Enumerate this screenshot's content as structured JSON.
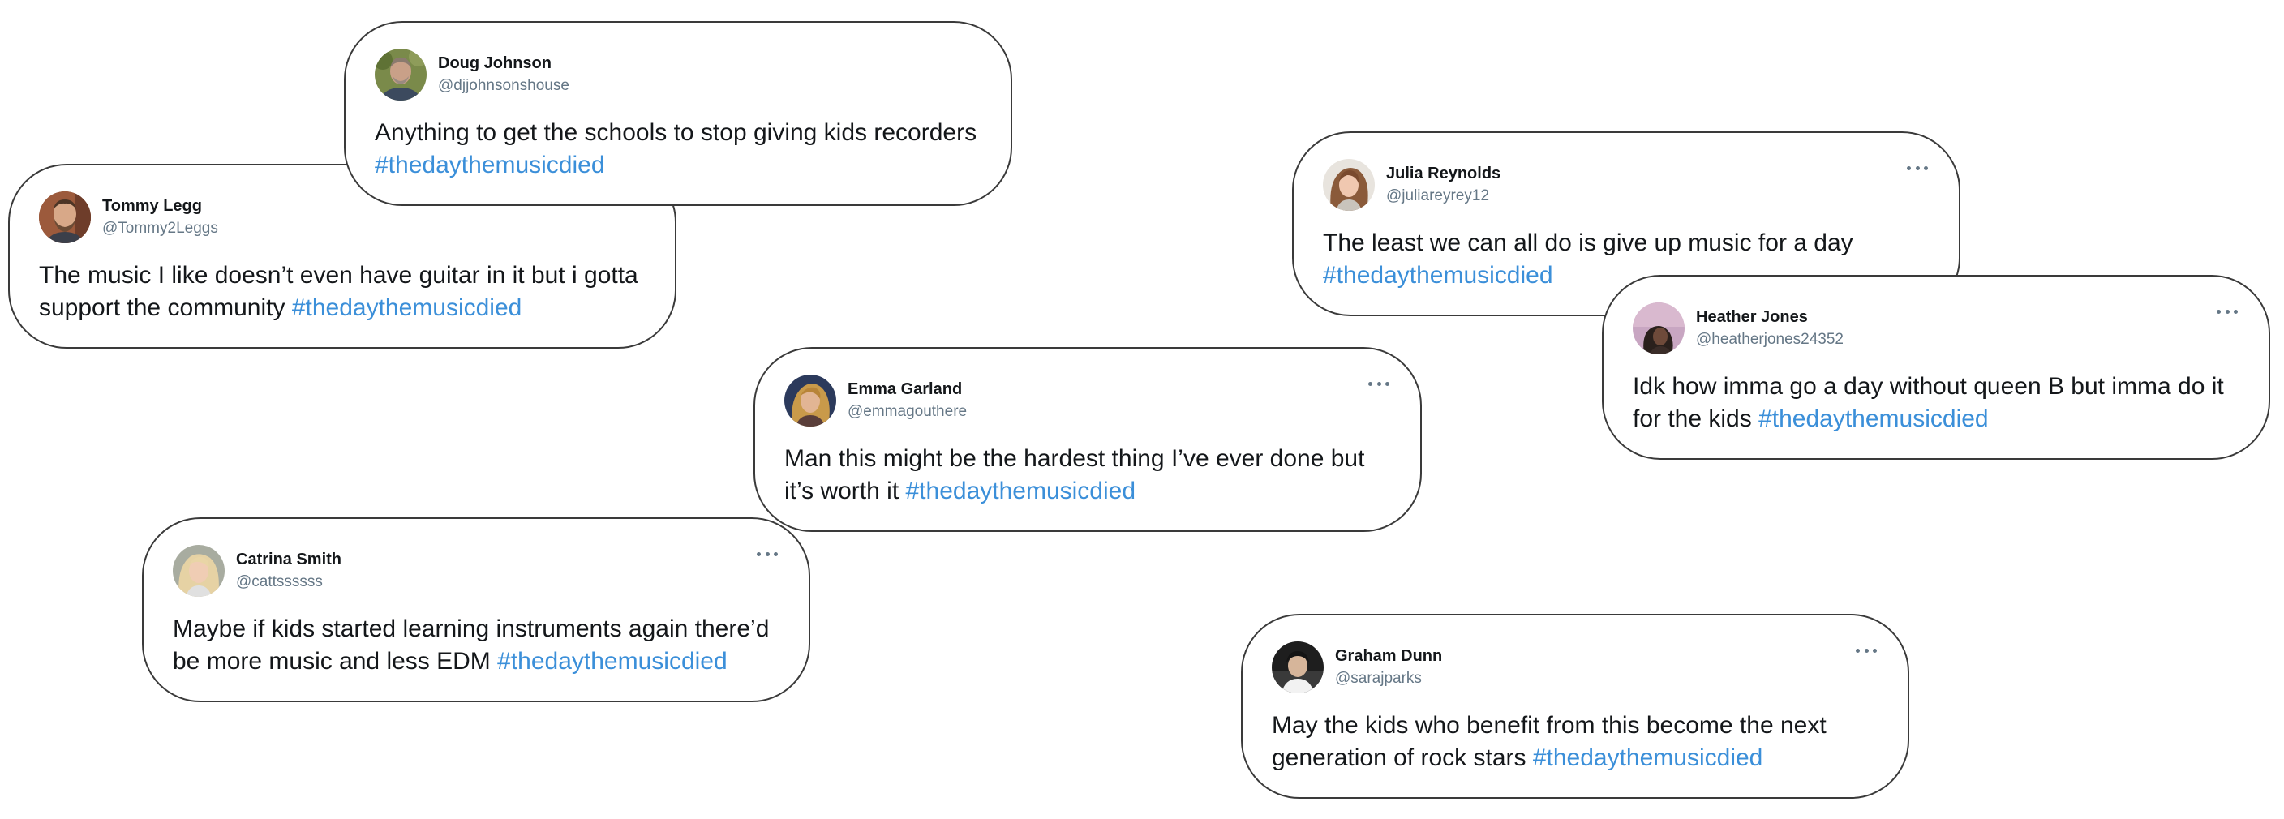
{
  "tweets": {
    "tommy": {
      "name": "Tommy Legg",
      "handle": "@Tommy2Leggs",
      "text": "The music I like doesn’t even have guitar in it but i gotta support the community ",
      "hashtag": "#thedaythemusicdied"
    },
    "doug": {
      "name": "Doug Johnson",
      "handle": "@djjohnsonshouse",
      "text": "Anything to get the schools to stop giving kids recorders ",
      "hashtag": "#thedaythemusicdied"
    },
    "emma": {
      "name": "Emma Garland",
      "handle": "@emmagouthere",
      "text": "Man this might be the hardest thing I’ve ever done but it’s worth it ",
      "hashtag": "#thedaythemusicdied"
    },
    "catrina": {
      "name": "Catrina Smith",
      "handle": "@cattssssss",
      "text": "Maybe if kids started learning instruments again there’d be more music and less EDM ",
      "hashtag": "#thedaythemusicdied"
    },
    "julia": {
      "name": "Julia Reynolds",
      "handle": "@juliareyrey12",
      "text": "The least we can all do is give up music for a day ",
      "hashtag": "#thedaythemusicdied"
    },
    "heather": {
      "name": "Heather Jones",
      "handle": "@heatherjones24352",
      "text": "Idk how imma go a day without queen B but imma do it for the kids ",
      "hashtag": "#thedaythemusicdied"
    },
    "graham": {
      "name": "Graham Dunn",
      "handle": "@sarajparks",
      "text": "May the kids who benefit from this become the next generation of rock stars ",
      "hashtag": "#thedaythemusicdied"
    }
  },
  "icons": {
    "more": "more-options-icon",
    "avatar": "avatar"
  },
  "colors": {
    "hashtag": "#3b8fd9",
    "handle": "#657786",
    "text": "#14171a",
    "border": "#3a3a3a"
  }
}
